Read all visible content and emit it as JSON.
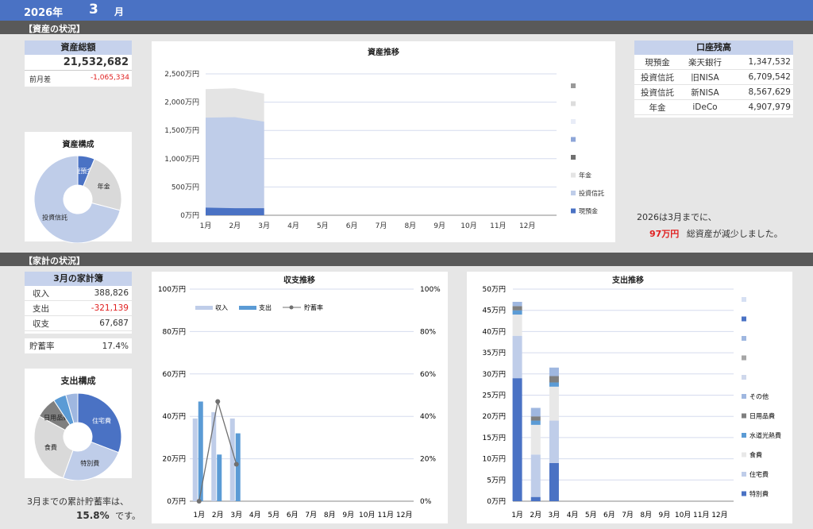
{
  "header": {
    "year": "2026年",
    "month": "3",
    "month_unit": "月"
  },
  "sections": {
    "assets": "【資産の状況】",
    "household": "【家計の状況】"
  },
  "total_assets": {
    "title": "資産総額",
    "value": "21,532,682",
    "diff_label": "前月差",
    "diff_value": "-1,065,334"
  },
  "asset_comp": {
    "title": "資産構成",
    "labels": [
      "現預金",
      "年金",
      "投資信託"
    ],
    "values": [
      1347532,
      4907979,
      15277171
    ],
    "colors": [
      "#4a72c4",
      "#d9d9d9",
      "#bfcde9"
    ]
  },
  "accounts": {
    "title": "口座残高",
    "rows": [
      {
        "type": "現預金",
        "name": "楽天銀行",
        "amount": "1,347,532"
      },
      {
        "type": "投資信託",
        "name": "旧NISA",
        "amount": "6,709,542"
      },
      {
        "type": "投資信託",
        "name": "新NISA",
        "amount": "8,567,629"
      },
      {
        "type": "年金",
        "name": "iDeCo",
        "amount": "4,907,979"
      }
    ]
  },
  "asset_trend": {
    "title": "資産推移",
    "yticks": [
      "0万円",
      "500万円",
      "1,000万円",
      "1,500万円",
      "2,000万円",
      "2,500万円"
    ],
    "months": [
      "1月",
      "2月",
      "3月",
      "4月",
      "5月",
      "6月",
      "7月",
      "8月",
      "9月",
      "10月",
      "11月",
      "12月"
    ],
    "legend": [
      "年金",
      "投資信託",
      "現預金"
    ]
  },
  "asset_note": {
    "line1": "2026は3月までに、",
    "amount": "97万円",
    "line2": "総資産が減少しました。"
  },
  "kakeibo": {
    "title": "3月の家計簿",
    "rows": [
      {
        "label": "収入",
        "value": "388,826"
      },
      {
        "label": "支出",
        "value": "-321,139"
      },
      {
        "label": "収支",
        "value": "67,687"
      }
    ],
    "rate_label": "貯蓄率",
    "rate_value": "17.4%"
  },
  "expense_comp": {
    "title": "支出構成",
    "labels": [
      "住宅費",
      "特別費",
      "食費",
      "日用品費",
      "水道光熱費",
      "その他"
    ],
    "values": [
      90000,
      72000,
      80000,
      23000,
      14000,
      13000
    ],
    "colors": [
      "#4a72c4",
      "#bfcde9",
      "#d9d9d9",
      "#7f7f7f",
      "#5b9bd5",
      "#9fb7e0"
    ]
  },
  "savings_note": {
    "line1": "3月までの累計貯蓄率は、",
    "value": "15.8%",
    "line2": "です。"
  },
  "chart_data": [
    {
      "type": "area",
      "title": "資産推移",
      "unit": "万円",
      "x": [
        "1月",
        "2月",
        "3月"
      ],
      "ylim": [
        0,
        2500
      ],
      "series": [
        {
          "name": "現預金",
          "values": [
            135,
            125,
            125
          ]
        },
        {
          "name": "投資信託",
          "values": [
            1590,
            1610,
            1530
          ]
        },
        {
          "name": "年金",
          "values": [
            505,
            510,
            495
          ]
        }
      ]
    },
    {
      "type": "bar",
      "title": "収支推移",
      "unit": "万円",
      "categories": [
        "1月",
        "2月",
        "3月"
      ],
      "ylim": [
        0,
        100
      ],
      "y2lim": [
        0,
        100
      ],
      "series": [
        {
          "name": "収入",
          "values": [
            39,
            42,
            39
          ]
        },
        {
          "name": "支出",
          "values": [
            47,
            22,
            32
          ]
        },
        {
          "name": "貯蓄率",
          "values": [
            0,
            47,
            17.4
          ],
          "axis": "right"
        }
      ]
    },
    {
      "type": "bar",
      "title": "支出推移",
      "unit": "万円",
      "categories": [
        "1月",
        "2月",
        "3月"
      ],
      "ylim": [
        0,
        50
      ],
      "series": [
        {
          "name": "特別費",
          "values": [
            29,
            1,
            9
          ]
        },
        {
          "name": "住宅費",
          "values": [
            10,
            10,
            10
          ]
        },
        {
          "name": "食費",
          "values": [
            5,
            7,
            8
          ]
        },
        {
          "name": "水道光熱費",
          "values": [
            1,
            1,
            1
          ]
        },
        {
          "name": "日用品費",
          "values": [
            1,
            1,
            1.5
          ]
        },
        {
          "name": "その他",
          "values": [
            1,
            2,
            2
          ]
        }
      ]
    }
  ]
}
